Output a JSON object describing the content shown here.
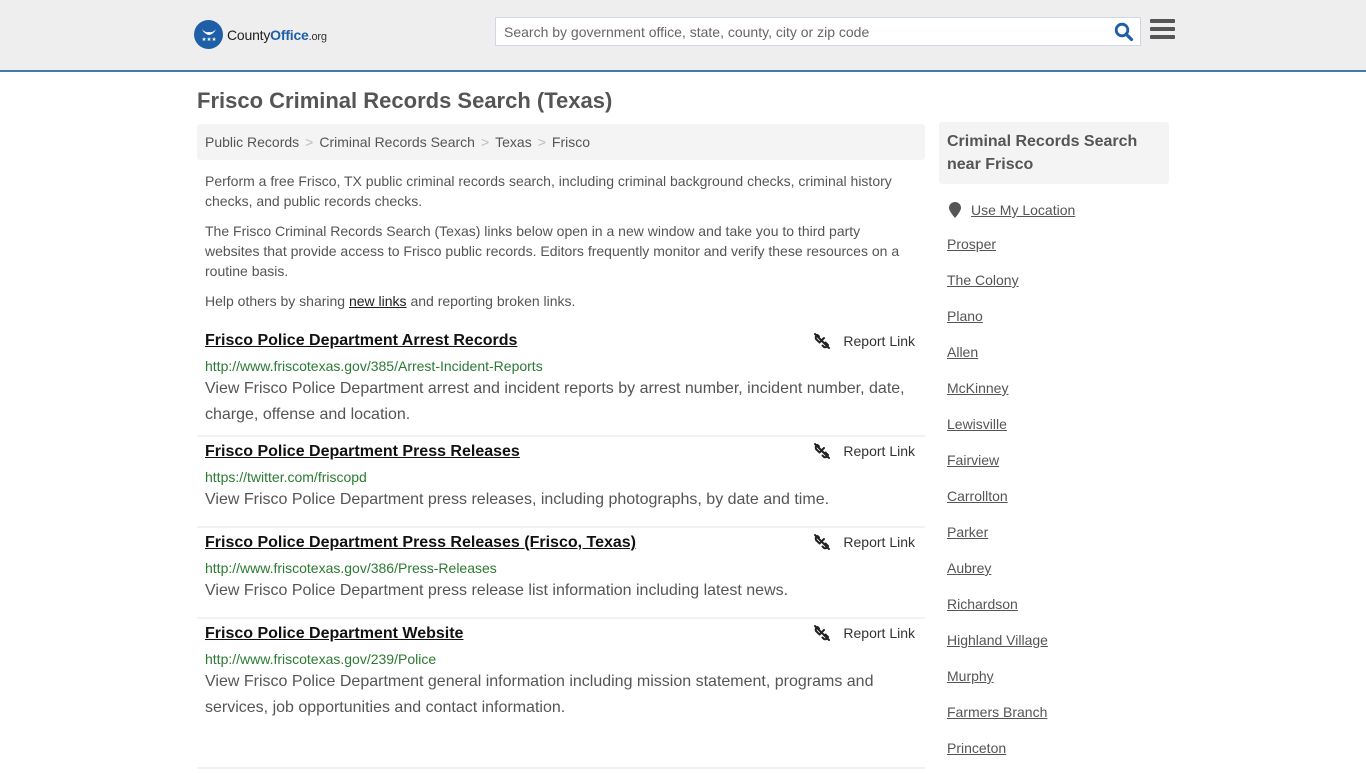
{
  "header": {
    "logo": {
      "name_part1": "County",
      "name_part2": "Office",
      "name_suffix": ".org",
      "brand_color": "#1f5fa8"
    },
    "search": {
      "placeholder": "Search by government office, state, county, city or zip code",
      "value": ""
    },
    "icons": {
      "search": "search-icon",
      "menu": "hamburger-menu-icon"
    }
  },
  "page": {
    "title": "Frisco Criminal Records Search (Texas)",
    "breadcrumb": [
      {
        "label": "Public Records"
      },
      {
        "label": "Criminal Records Search"
      },
      {
        "label": "Texas"
      },
      {
        "label": "Frisco"
      }
    ],
    "breadcrumb_separator": ">",
    "intro": {
      "p1": "Perform a free Frisco, TX public criminal records search, including criminal background checks, criminal history checks, and public records checks.",
      "p2": "The Frisco Criminal Records Search (Texas) links below open in a new window and take you to third party websites that provide access to Frisco public records. Editors frequently monitor and verify these resources on a routine basis.",
      "p3_before": "Help others by sharing ",
      "p3_link": "new links",
      "p3_after": " and reporting broken links."
    }
  },
  "results": [
    {
      "title": "Frisco Police Department Arrest Records",
      "url": "http://www.friscotexas.gov/385/Arrest-Incident-Reports",
      "description": "View Frisco Police Department arrest and incident reports by arrest number, incident number, date, charge, offense and location.",
      "report_label": "Report Link"
    },
    {
      "title": "Frisco Police Department Press Releases",
      "url": "https://twitter.com/friscopd",
      "description": "View Frisco Police Department press releases, including photographs, by date and time.",
      "report_label": "Report Link"
    },
    {
      "title": "Frisco Police Department Press Releases (Frisco, Texas)",
      "url": "http://www.friscotexas.gov/386/Press-Releases",
      "description": "View Frisco Police Department press release list information including latest news.",
      "report_label": "Report Link"
    },
    {
      "title": "Frisco Police Department Website",
      "url": "http://www.friscotexas.gov/239/Police",
      "description": "View Frisco Police Department general information including mission statement, programs and services, job opportunities and contact information.",
      "report_label": "Report Link"
    }
  ],
  "sidebar": {
    "heading": "Criminal Records Search near Frisco",
    "use_location": "Use My Location",
    "cities": [
      "Prosper",
      "The Colony",
      "Plano",
      "Allen",
      "McKinney",
      "Lewisville",
      "Fairview",
      "Carrollton",
      "Parker",
      "Aubrey",
      "Richardson",
      "Highland Village",
      "Murphy",
      "Farmers Branch",
      "Princeton"
    ]
  },
  "colors": {
    "header_bg": "#eeeeee",
    "header_border": "#3f7aaa",
    "url_green": "#2b7a32",
    "text_gray": "#555555"
  }
}
